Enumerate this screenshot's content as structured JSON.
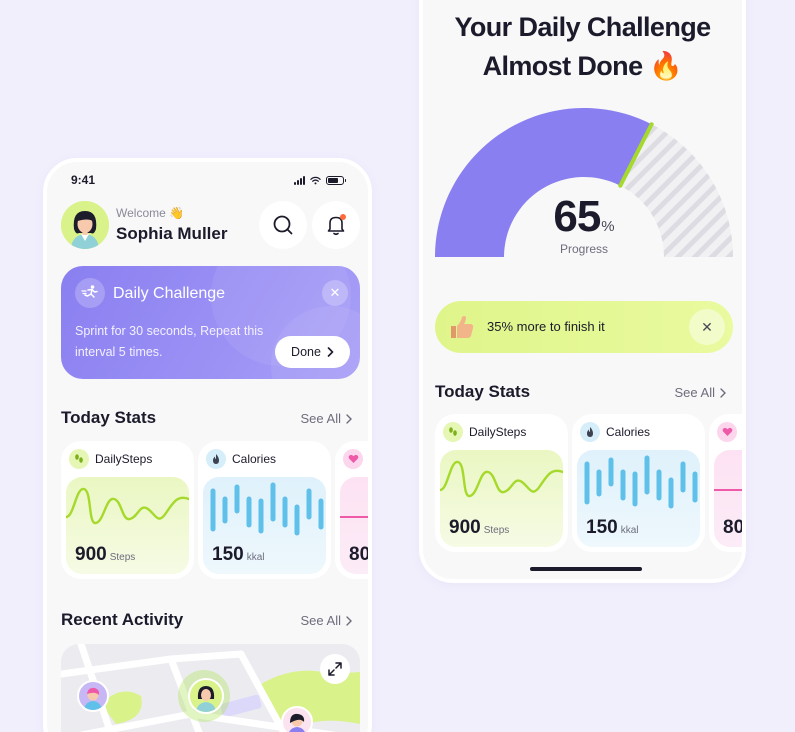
{
  "left_phone": {
    "status": {
      "time": "9:41"
    },
    "header": {
      "welcome": "Welcome 👋",
      "name": "Sophia Muller"
    },
    "challenge": {
      "title": "Daily Challenge",
      "description": "Sprint for 30 seconds, Repeat this interval 5 times.",
      "done_label": "Done",
      "close": "✕"
    },
    "today_stats": {
      "title": "Today Stats",
      "see_all": "See All"
    },
    "stats": {
      "steps": {
        "label": "DailySteps",
        "value": "900",
        "unit": "Steps"
      },
      "calories": {
        "label": "Calories",
        "value": "150",
        "unit": "kkal"
      },
      "heart": {
        "value": "80"
      }
    },
    "recent": {
      "title": "Recent Activity",
      "see_all": "See All"
    }
  },
  "right_phone": {
    "title_line1": "Your Daily Challenge",
    "title_line2": "Almost Done 🔥",
    "progress": {
      "value": "65",
      "unit": "%",
      "label": "Progress",
      "fraction": 0.65
    },
    "more": {
      "text": "35% more to finish it",
      "close": "✕"
    },
    "today_stats": {
      "title": "Today Stats",
      "see_all": "See All"
    },
    "stats": {
      "steps": {
        "label": "DailySteps",
        "value": "900",
        "unit": "Steps"
      },
      "calories": {
        "label": "Calories",
        "value": "150",
        "unit": "kkal"
      },
      "heart": {
        "value": "80"
      }
    }
  },
  "colors": {
    "background": "#f1effc",
    "accent_purple": "#8a7ff0",
    "accent_lime": "#dff58a",
    "chart_green": "#a5d92b",
    "chart_blue": "#5fc0ea",
    "chart_pink": "#ee5aa8"
  },
  "icons": [
    "signal-icon",
    "wifi-icon",
    "battery-icon",
    "search-icon",
    "bell-icon",
    "running-icon",
    "close-icon",
    "chevron-right-icon",
    "footprints-icon",
    "flame-icon",
    "heart-icon",
    "expand-icon",
    "thumbs-up-icon"
  ]
}
